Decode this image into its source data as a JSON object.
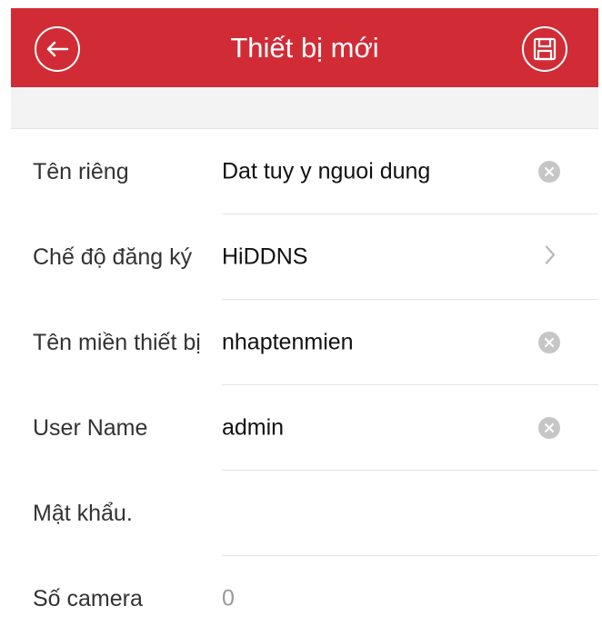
{
  "colors": {
    "accent": "#d12c36"
  },
  "header": {
    "title": "Thiết bị mới",
    "back_icon": "arrow-left-circle-icon",
    "save_icon": "floppy-disk-icon"
  },
  "form": {
    "rows": [
      {
        "label": "Tên riêng",
        "value": "Dat tuy y nguoi dung",
        "action": "clear-icon"
      },
      {
        "label": "Chế độ đăng ký",
        "value": "HiDDNS",
        "action": "chevron-right-icon"
      },
      {
        "label": "Tên miền thiết bị",
        "value": "nhaptenmien",
        "action": "clear-icon"
      },
      {
        "label": "User Name",
        "value": "admin",
        "action": "clear-icon"
      },
      {
        "label": "Mật khẩu.",
        "value": "",
        "action": ""
      },
      {
        "label": "Số camera",
        "value": "0",
        "action": ""
      }
    ]
  }
}
